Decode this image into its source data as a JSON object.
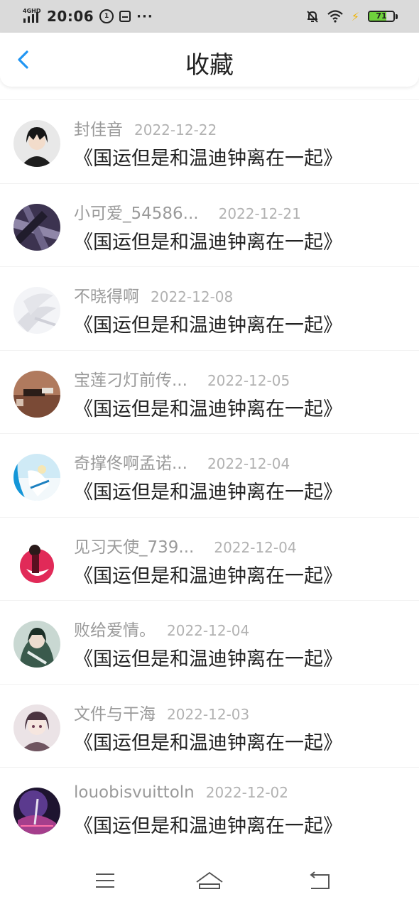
{
  "status_bar": {
    "network": "4GHD",
    "time": "20:06",
    "circle_label": "1",
    "dots": "···",
    "battery": "71",
    "battery_level": 0.71
  },
  "header": {
    "title": "收藏"
  },
  "items": [
    {
      "name": "封佳音",
      "date": "2022-12-22",
      "title": "《国运但是和温迪钟离在一起》"
    },
    {
      "name": "小可爱_54586...",
      "date": "2022-12-21",
      "title": "《国运但是和温迪钟离在一起》"
    },
    {
      "name": "不晓得啊",
      "date": "2022-12-08",
      "title": "《国运但是和温迪钟离在一起》"
    },
    {
      "name": "宝莲刁灯前传...",
      "date": "2022-12-05",
      "title": "《国运但是和温迪钟离在一起》"
    },
    {
      "name": "奇撑佟啊孟诺...",
      "date": "2022-12-04",
      "title": "《国运但是和温迪钟离在一起》"
    },
    {
      "name": "见习天使_739...",
      "date": "2022-12-04",
      "title": "《国运但是和温迪钟离在一起》"
    },
    {
      "name": "败给爱情。",
      "date": "2022-12-04",
      "title": "《国运但是和温迪钟离在一起》"
    },
    {
      "name": "文件与干海",
      "date": "2022-12-03",
      "title": "《国运但是和温迪钟离在一起》"
    },
    {
      "name": "louobisvuittoln",
      "date": "2022-12-02",
      "title": "《国运但是和温迪钟离在一起》"
    }
  ],
  "colors": {
    "accent": "#2196f3",
    "status_bar_bg": "#dadada",
    "name_text": "#9a9a9a",
    "date_text": "#b2b2b2",
    "title_text": "#222222",
    "battery_fill": "#6fd23c"
  },
  "icons": {
    "back": "chevron-left-icon",
    "menu": "menu-icon",
    "home": "home-icon",
    "return": "return-icon"
  }
}
